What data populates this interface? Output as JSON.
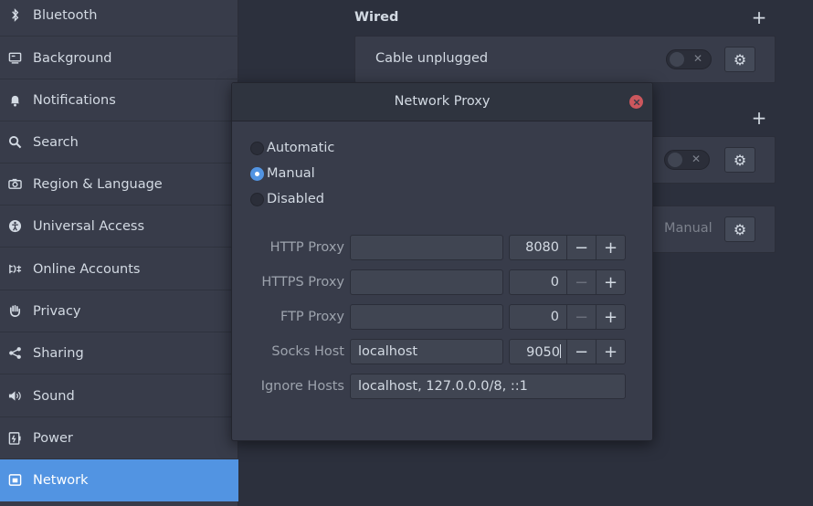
{
  "sidebar": {
    "items": [
      {
        "label": "Bluetooth",
        "icon": "bluetooth-icon"
      },
      {
        "label": "Background",
        "icon": "background-icon"
      },
      {
        "label": "Notifications",
        "icon": "bell-icon"
      },
      {
        "label": "Search",
        "icon": "search-icon"
      },
      {
        "label": "Region & Language",
        "icon": "camera-icon"
      },
      {
        "label": "Universal Access",
        "icon": "accessibility-icon"
      },
      {
        "label": "Online Accounts",
        "icon": "online-accounts-icon"
      },
      {
        "label": "Privacy",
        "icon": "hand-icon"
      },
      {
        "label": "Sharing",
        "icon": "share-icon"
      },
      {
        "label": "Sound",
        "icon": "speaker-icon"
      },
      {
        "label": "Power",
        "icon": "power-icon"
      },
      {
        "label": "Network",
        "icon": "network-icon",
        "active": true
      }
    ]
  },
  "main": {
    "wired_title": "Wired",
    "wired_card_label": "Cable unplugged",
    "proxy_card_value": "Manual"
  },
  "dialog": {
    "title": "Network Proxy",
    "modes": [
      {
        "label": "Automatic",
        "selected": false
      },
      {
        "label": "Manual",
        "selected": true
      },
      {
        "label": "Disabled",
        "selected": false
      }
    ],
    "http": {
      "label": "HTTP Proxy",
      "host": "",
      "port": "8080"
    },
    "https": {
      "label": "HTTPS Proxy",
      "host": "",
      "port": "0"
    },
    "ftp": {
      "label": "FTP Proxy",
      "host": "",
      "port": "0"
    },
    "socks": {
      "label": "Socks Host",
      "host": "localhost",
      "port": "9050"
    },
    "ignore": {
      "label": "Ignore Hosts",
      "value": "localhost, 127.0.0.0/8, ::1"
    }
  },
  "colors": {
    "accent": "#5294e2",
    "sidebar_bg": "#383c4a",
    "window_bg": "#2c303d",
    "close_button": "#cc575d"
  }
}
